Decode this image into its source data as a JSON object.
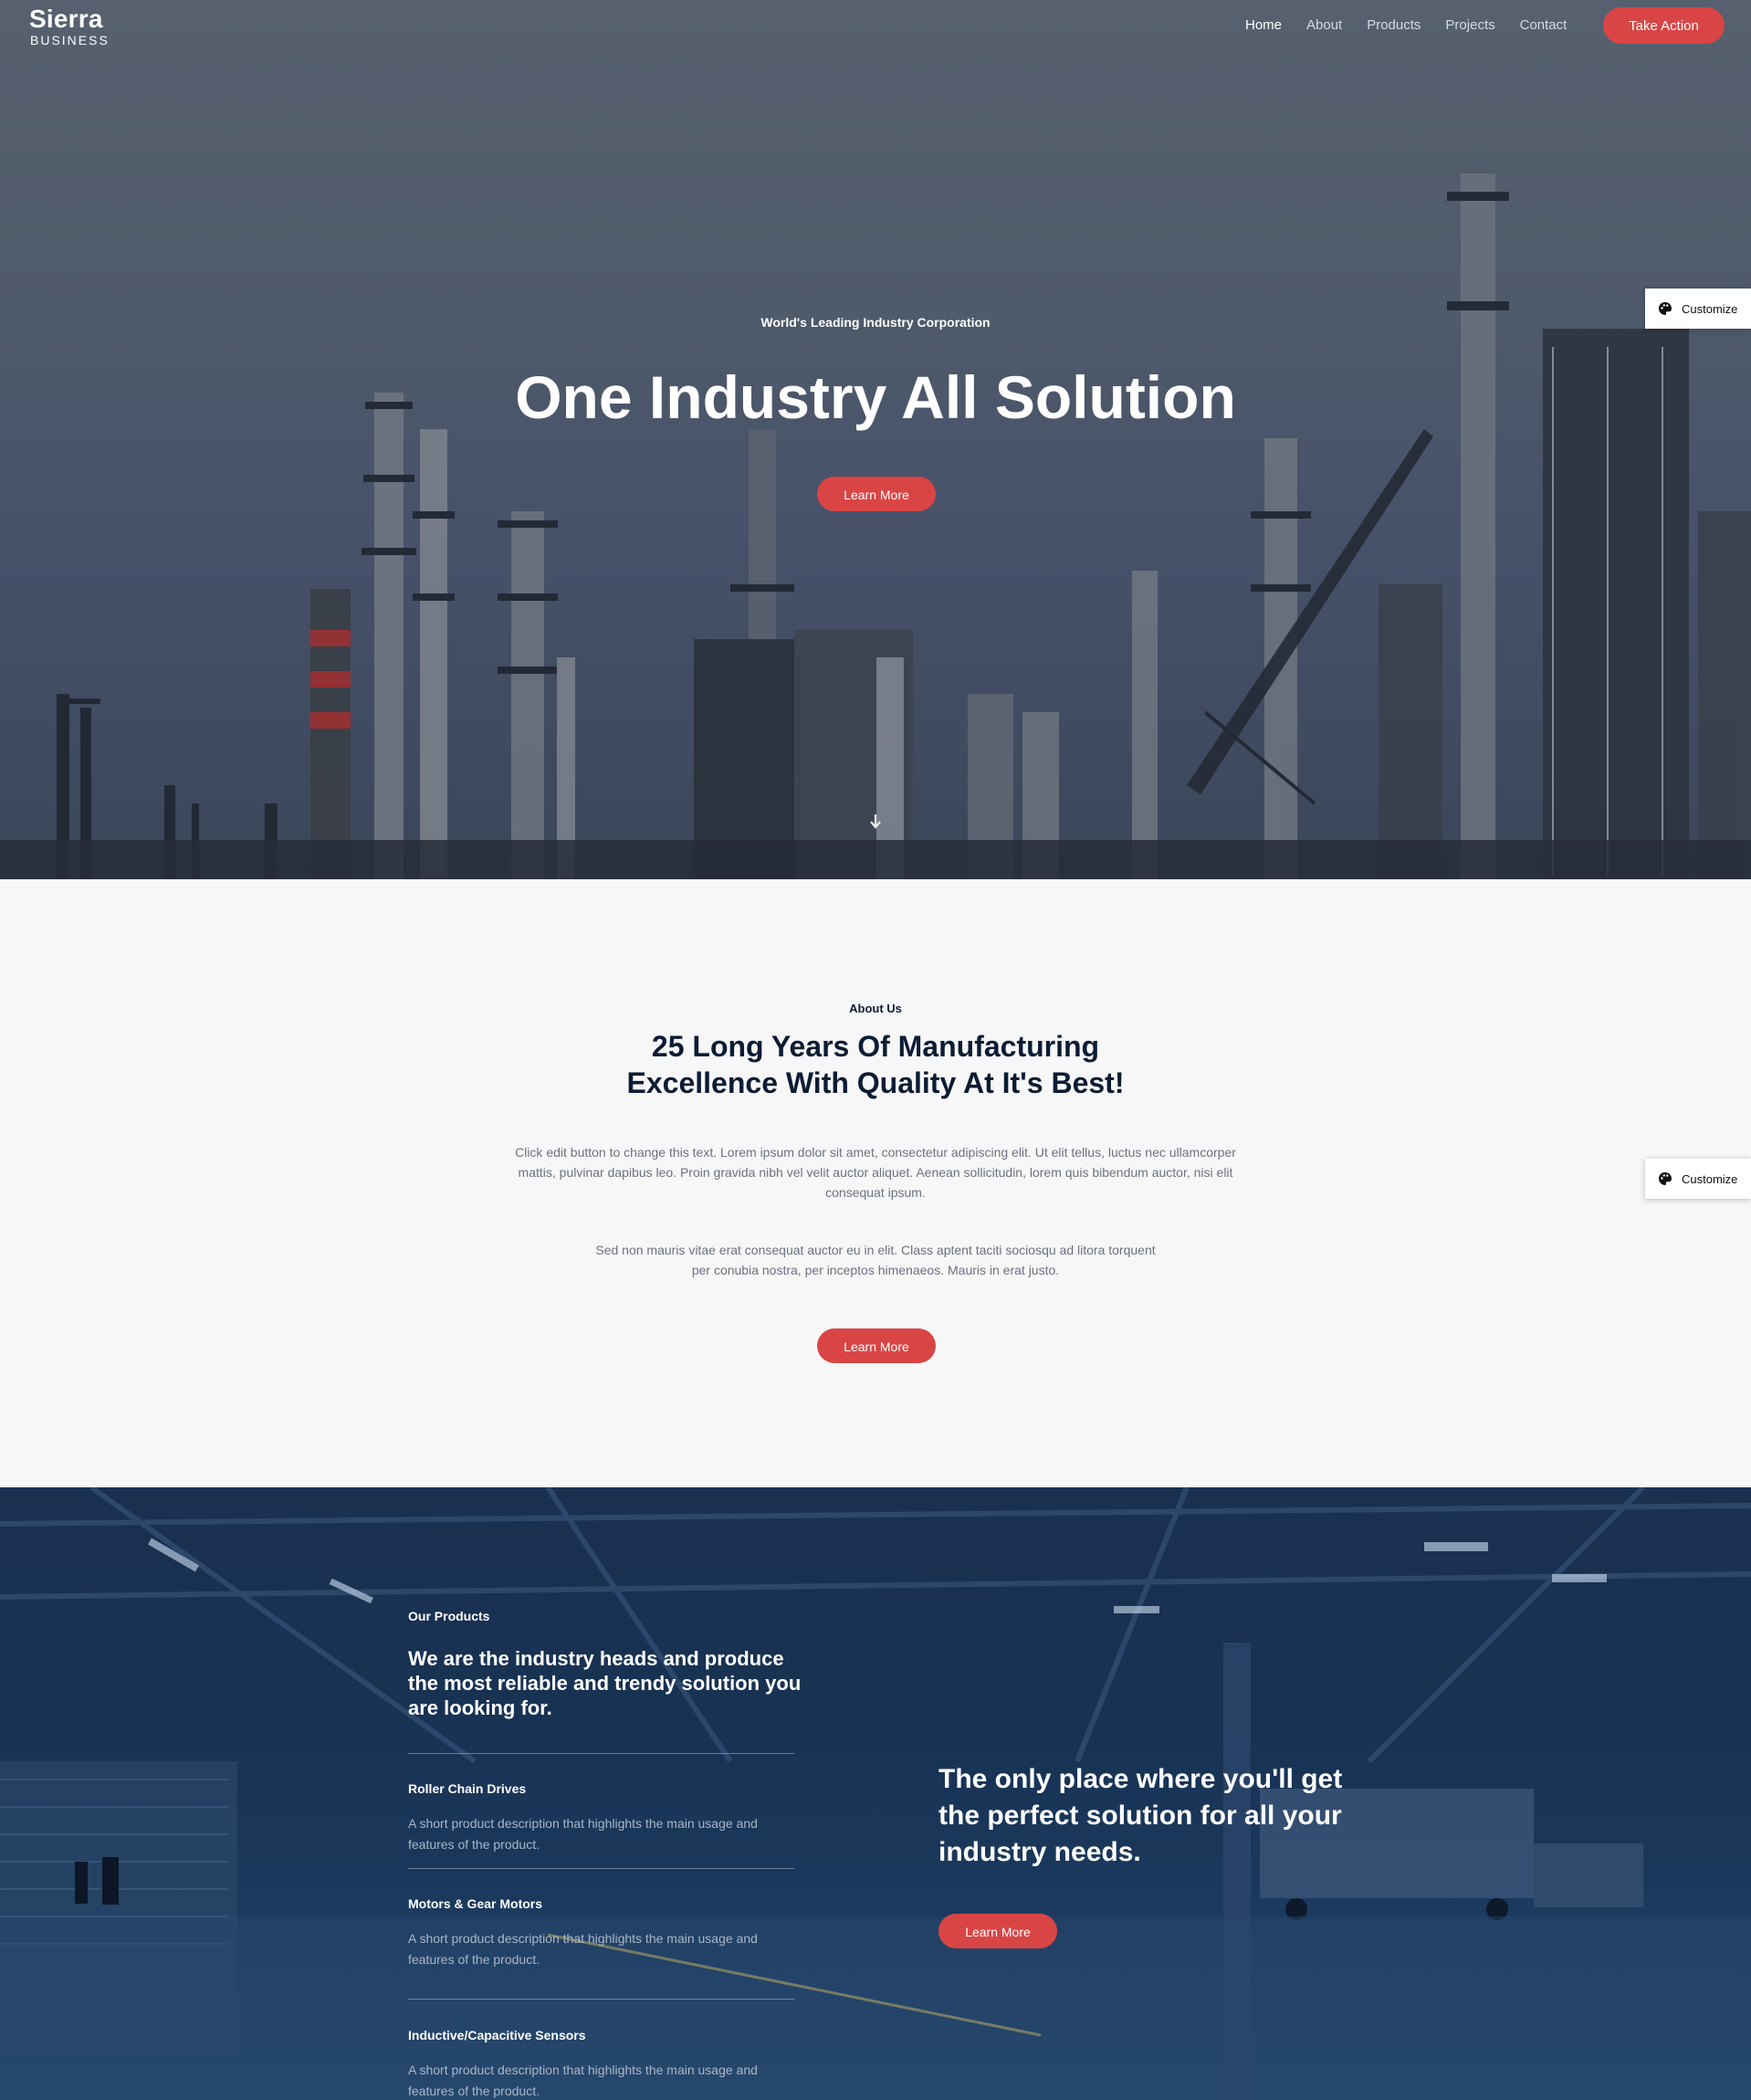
{
  "header": {
    "logo_name": "Sierra",
    "logo_sub": "BUSINESS",
    "nav": [
      {
        "label": "Home",
        "active": true
      },
      {
        "label": "About",
        "active": false
      },
      {
        "label": "Products",
        "active": false
      },
      {
        "label": "Projects",
        "active": false
      },
      {
        "label": "Contact",
        "active": false
      }
    ],
    "cta_label": "Take Action"
  },
  "hero": {
    "eyebrow": "World's Leading Industry Corporation",
    "title": "One Industry All Solution",
    "button_label": "Learn More",
    "scroll_icon": "chevron-down-icon"
  },
  "customize": {
    "label": "Customize",
    "icon": "palette-icon"
  },
  "about": {
    "eyebrow": "About Us",
    "title_line1": "25 Long Years Of Manufacturing",
    "title_line2": "Excellence With Quality At It's Best!",
    "paragraph1": "Click edit button to change this text. Lorem ipsum dolor sit amet, consectetur adipiscing elit. Ut elit tellus, luctus nec ullamcorper mattis, pulvinar dapibus leo. Proin gravida nibh vel velit auctor aliquet. Aenean sollicitudin, lorem quis bibendum auctor, nisi elit consequat ipsum.",
    "paragraph2": "Sed non mauris vitae erat consequat auctor eu in elit. Class aptent taciti sociosqu ad litora torquent per conubia nostra, per inceptos himenaeos. Mauris in erat justo.",
    "button_label": "Learn More"
  },
  "products": {
    "eyebrow": "Our Products",
    "title": "We are the industry heads and produce the most reliable and trendy solution you are looking for.",
    "items": [
      {
        "title": "Roller Chain Drives",
        "description": "A short product description that highlights the main usage and features of the product."
      },
      {
        "title": "Motors & Gear Motors",
        "description": "A short product description that highlights the main usage and features of the product."
      },
      {
        "title": "Inductive/Capacitive Sensors",
        "description": "A short product description that highlights the main usage and features of the product."
      }
    ],
    "tagline": "The only place where you'll get the perfect solution for all your industry needs.",
    "button_label": "Learn More"
  },
  "colors": {
    "accent": "#d94545",
    "navy": "#0c1c33",
    "hero_overlay": "#4f5a6a",
    "products_overlay": "#183253"
  }
}
